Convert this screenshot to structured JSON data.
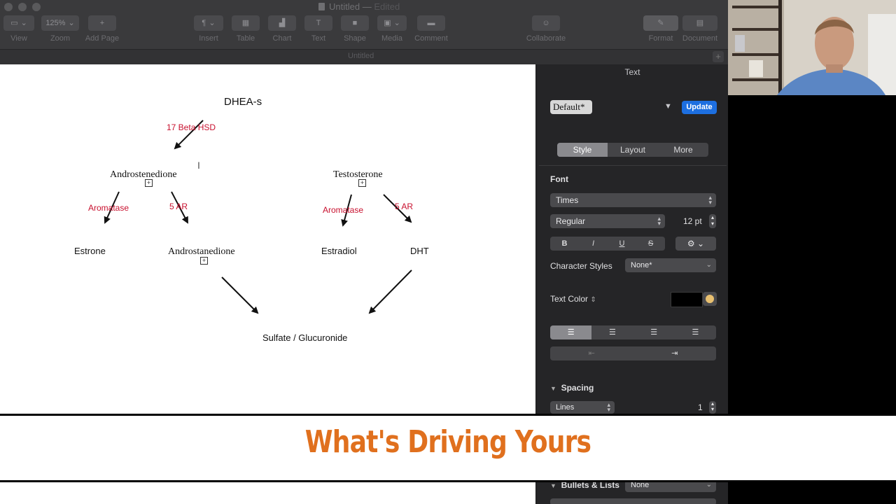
{
  "window": {
    "title": "Untitled",
    "status": "Edited",
    "tab_title": "Untitled"
  },
  "toolbar": {
    "view": "View",
    "zoom_value": "125%",
    "zoom": "Zoom",
    "add_page": "Add Page",
    "insert": "Insert",
    "table": "Table",
    "chart": "Chart",
    "text": "Text",
    "shape": "Shape",
    "media": "Media",
    "comment": "Comment",
    "collaborate": "Collaborate",
    "format": "Format",
    "document": "Document"
  },
  "diagram": {
    "nodes": {
      "dhea": "DHEA-s",
      "androstenedione": "Androstenedione",
      "testosterone": "Testosterone",
      "estrone": "Estrone",
      "androstanedione": "Androstanedione",
      "estradiol": "Estradiol",
      "dht": "DHT",
      "sulfate": "Sulfate / Glucuronide"
    },
    "enzymes": {
      "beta_hsd": "17 Beta HSD",
      "aromatase_left": "Aromatase",
      "ar_left": "5 AR",
      "aromatase_right": "Aromatase",
      "ar_right": "5 AR"
    },
    "enzyme_color": "#c8102e"
  },
  "inspector": {
    "title": "Text",
    "style_name": "Default*",
    "update": "Update",
    "tabs": [
      "Style",
      "Layout",
      "More"
    ],
    "font_label": "Font",
    "font_family": "Times",
    "font_weight": "Regular",
    "font_size": "12 pt",
    "bold": "B",
    "italic": "I",
    "underline": "U",
    "strike": "S",
    "character_styles_label": "Character Styles",
    "character_styles_value": "None*",
    "text_color_label": "Text Color",
    "text_color": "#000000",
    "spacing_label": "Spacing",
    "lines_label": "Lines",
    "lines_value": "1",
    "bullets_label": "Bullets & Lists",
    "bullets_value": "None"
  },
  "banner": {
    "text": "What's Driving Yours",
    "color": "#e0701e"
  }
}
